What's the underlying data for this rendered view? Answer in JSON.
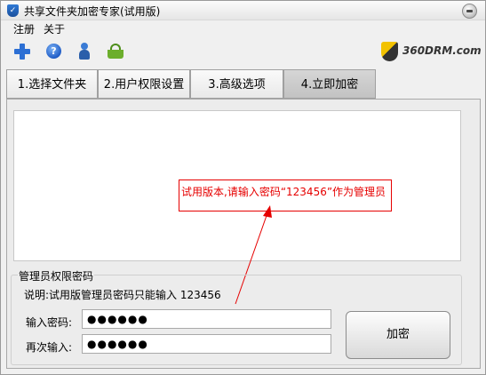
{
  "window": {
    "title": "共享文件夹加密专家(试用版)"
  },
  "menu": {
    "items": [
      "注册",
      "关于"
    ]
  },
  "toolbar": {
    "icons": [
      "add-icon",
      "help-icon",
      "user-icon",
      "basket-icon"
    ],
    "logo_text": "360DRM.com"
  },
  "tabs": [
    {
      "label": "1.选择文件夹",
      "active": false
    },
    {
      "label": "2.用户权限设置",
      "active": false
    },
    {
      "label": "3.高级选项",
      "active": false
    },
    {
      "label": "4.立即加密",
      "active": true
    }
  ],
  "callout": {
    "text": "试用版本,请输入密码“123456”作为管理员"
  },
  "admin_group": {
    "title": "管理员权限密码",
    "note": "说明:试用版管理员密码只能输入 123456",
    "password_label": "输入密码:",
    "password_value": "●●●●●●",
    "confirm_label": "再次输入:",
    "confirm_value": "●●●●●●"
  },
  "encrypt_button": {
    "label": "加密"
  },
  "colors": {
    "callout": "#e60000",
    "active_tab": "#c8c8c8"
  }
}
